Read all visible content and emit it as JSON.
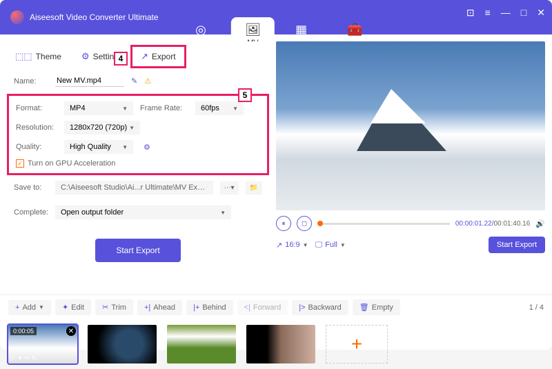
{
  "app": {
    "title": "Aiseesoft Video Converter Ultimate"
  },
  "nav": {
    "converter": "Converter",
    "mv": "MV",
    "collage": "Collage",
    "toolbox": "Toolbox"
  },
  "subtabs": {
    "theme": "Theme",
    "setting": "Setting",
    "export": "Export"
  },
  "callouts": {
    "c4": "4",
    "c5": "5"
  },
  "name": {
    "label": "Name:",
    "value": "New MV.mp4"
  },
  "settings": {
    "format": {
      "label": "Format:",
      "value": "MP4"
    },
    "framerate": {
      "label": "Frame Rate:",
      "value": "60fps"
    },
    "resolution": {
      "label": "Resolution:",
      "value": "1280x720 (720p)"
    },
    "quality": {
      "label": "Quality:",
      "value": "High Quality"
    },
    "gpu": "Turn on GPU Acceleration"
  },
  "saveto": {
    "label": "Save to:",
    "path": "C:\\Aiseesoft Studio\\Ai...r Ultimate\\MV Exported"
  },
  "complete": {
    "label": "Complete:",
    "value": "Open output folder"
  },
  "buttons": {
    "start_export": "Start Export",
    "start_export_sm": "Start Export"
  },
  "player": {
    "current": "00:00:01.22",
    "duration": "00:01:40.16",
    "ratio": "16:9",
    "full": "Full"
  },
  "toolbar": {
    "add": "Add",
    "edit": "Edit",
    "trim": "Trim",
    "ahead": "Ahead",
    "behind": "Behind",
    "forward": "Forward",
    "backward": "Backward",
    "empty": "Empty"
  },
  "pager": {
    "text": "1 / 4"
  },
  "thumbs": {
    "dur1": "0:00:05"
  }
}
